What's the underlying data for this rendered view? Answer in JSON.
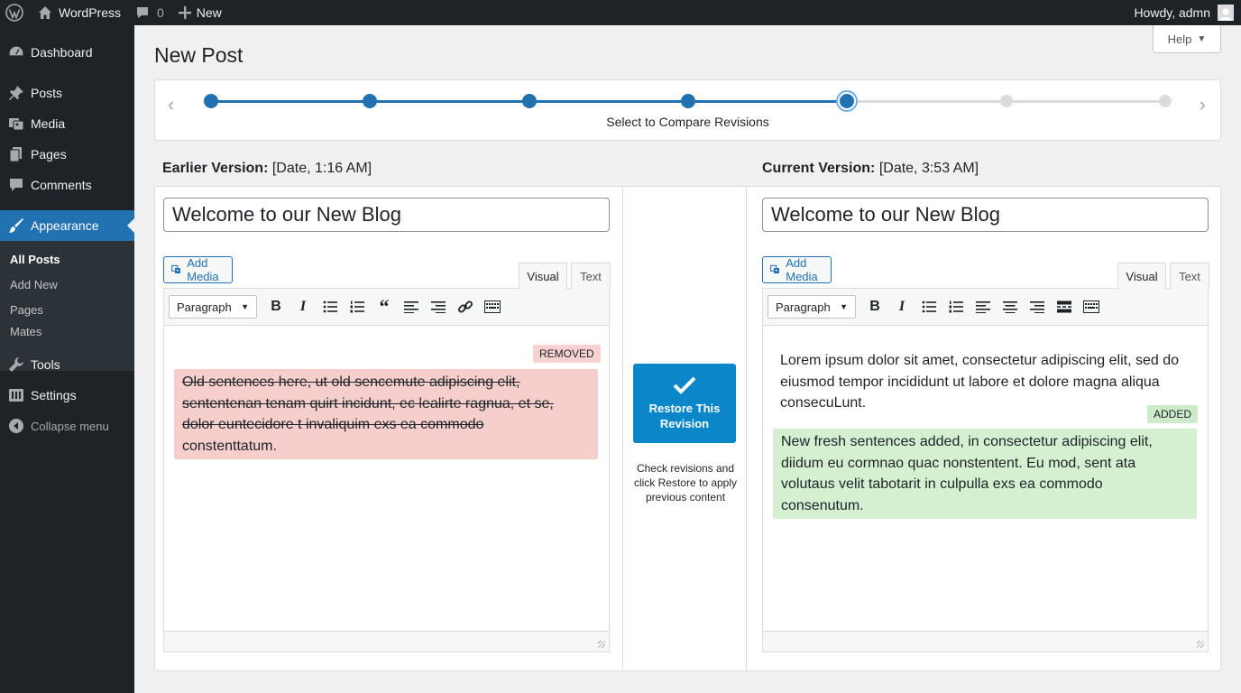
{
  "admin_bar": {
    "site_name": "WordPress",
    "comments_count": "0",
    "new_label": "New",
    "greeting": "Howdy, admn"
  },
  "sidebar": {
    "items": [
      {
        "label": "Dashboard",
        "icon": "dashboard-icon"
      },
      {
        "label": "Posts",
        "icon": "pin-icon"
      },
      {
        "label": "Media",
        "icon": "media-icon"
      },
      {
        "label": "Pages",
        "icon": "pages-icon"
      },
      {
        "label": "Comments",
        "icon": "comment-icon"
      },
      {
        "label": "Appearance",
        "icon": "brush-icon"
      },
      {
        "label": "Tools",
        "icon": "wrench-icon"
      },
      {
        "label": "Settings",
        "icon": "settings-icon"
      }
    ],
    "submenu": [
      "All Posts",
      "Add New",
      "Pages",
      "Mates"
    ],
    "collapse_label": "Collapse menu"
  },
  "page": {
    "title": "New Post",
    "help_label": "Help"
  },
  "revisions": {
    "caption": "Select to Compare Revisions",
    "total": 7,
    "selected_index": 5
  },
  "earlier": {
    "heading_label": "Earlier Version:",
    "heading_date": "[Date, 1:16 AM]",
    "post_title": "Welcome to our New Blog",
    "badge": "REMOVED",
    "removed_lines": [
      "Old sentences here, ut old sencemute adipiscing elit,",
      "sententenan tenam quirt incidunt, ec lealirte ragnua, et se,",
      "dolor euntecidore t invaliquim exs ea commodo"
    ],
    "removed_last": "constenttatum."
  },
  "current": {
    "heading_label": "Current Version:",
    "heading_date": "[Date, 3:53 AM]",
    "post_title": "Welcome to our New Blog",
    "paragraph": "Lorem ipsum dolor sit amet, consectetur adipiscing elit, sed do eiusmod tempor incididunt ut labore et dolore magna aliqua consecuLunt.",
    "badge": "ADDED",
    "added_text": "New fresh sentences added, in consectetur adipiscing elit, diidum eu cormnao quac nonstentent. Eu mod, sent ata volutaus velit tabotarit in culpulla exs ea commodo consenutum."
  },
  "editor": {
    "add_media": "Add Media",
    "tab_visual": "Visual",
    "tab_text": "Text",
    "format": "Paragraph"
  },
  "middle": {
    "restore_line1": "Restore This",
    "restore_line2": "Revision",
    "help_text": "Check revisions and click Restore to apply previous content"
  },
  "colors": {
    "accent": "#2271b1",
    "restore": "#0a87c9",
    "removed_bg": "#f6cfcd",
    "added_bg": "#d4f0d0"
  }
}
